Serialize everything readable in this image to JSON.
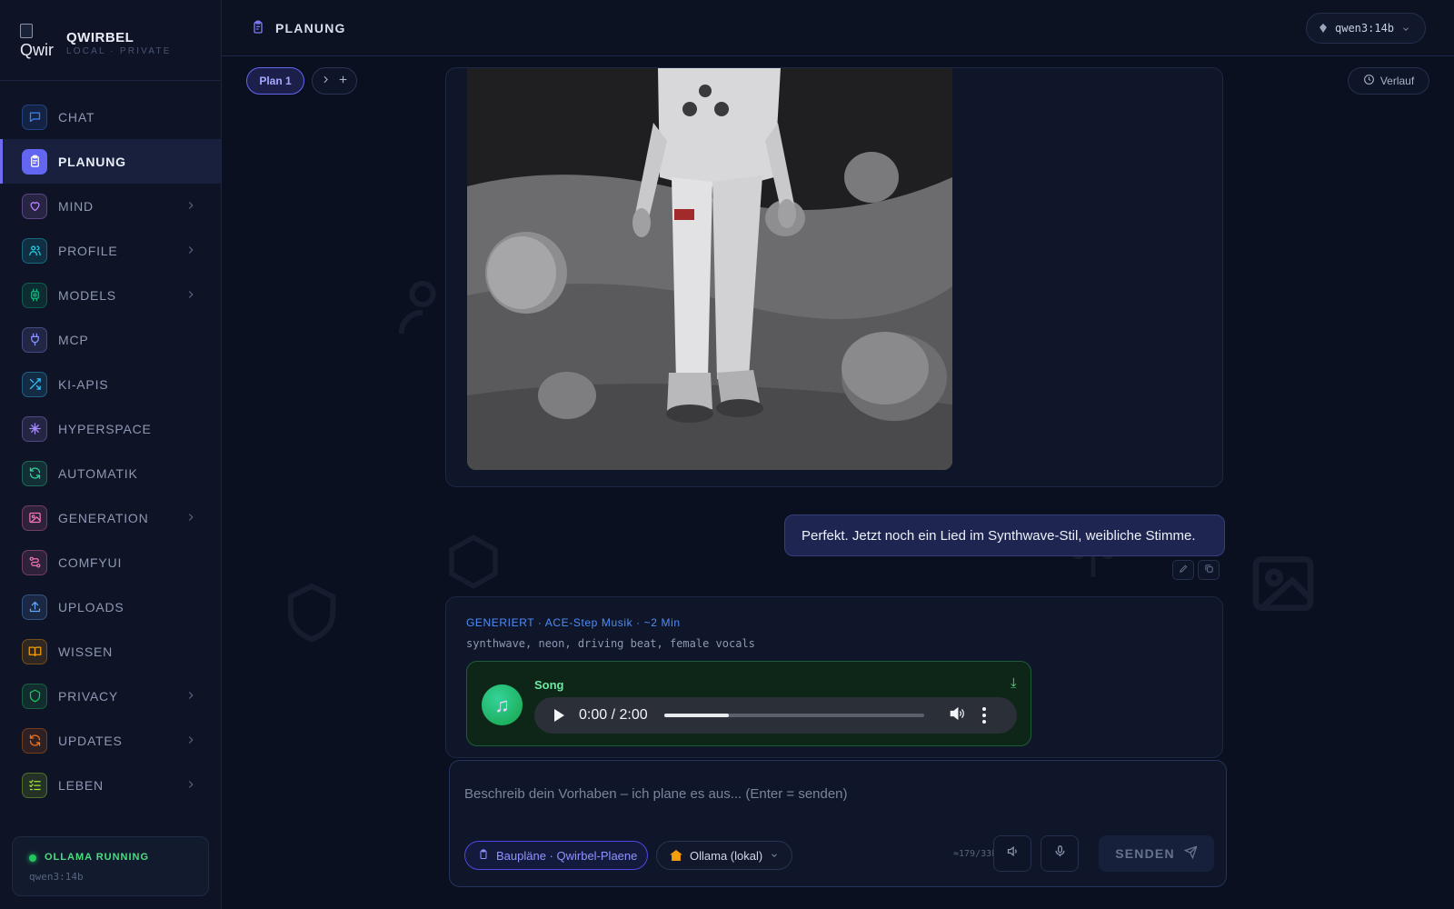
{
  "brand": {
    "logo_alt": "Qwir",
    "name": "QWIRBEL",
    "subtitle": "LOCAL · PRIVATE"
  },
  "sidebar": {
    "items": [
      {
        "label": "CHAT",
        "icon": "chat-icon",
        "color": "#3b82f6",
        "has_chevron": false,
        "active": false
      },
      {
        "label": "PLANUNG",
        "icon": "clipboard-icon",
        "color": "#6366f1",
        "has_chevron": false,
        "active": true
      },
      {
        "label": "MIND",
        "icon": "heart-icon",
        "color": "#c084fc",
        "has_chevron": true,
        "active": false
      },
      {
        "label": "PROFILE",
        "icon": "users-icon",
        "color": "#22d3ee",
        "has_chevron": true,
        "active": false
      },
      {
        "label": "MODELS",
        "icon": "cpu-icon",
        "color": "#10b981",
        "has_chevron": true,
        "active": false
      },
      {
        "label": "MCP",
        "icon": "plug-icon",
        "color": "#8b93ff",
        "has_chevron": false,
        "active": false
      },
      {
        "label": "KI-APIS",
        "icon": "shuffle-icon",
        "color": "#38bdf8",
        "has_chevron": false,
        "active": false
      },
      {
        "label": "HYPERSPACE",
        "icon": "sparkle-icon",
        "color": "#a78bfa",
        "has_chevron": false,
        "active": false
      },
      {
        "label": "AUTOMATIK",
        "icon": "refresh-icon",
        "color": "#34d399",
        "has_chevron": false,
        "active": false
      },
      {
        "label": "GENERATION",
        "icon": "image-icon",
        "color": "#f472b6",
        "has_chevron": true,
        "active": false
      },
      {
        "label": "COMFYUI",
        "icon": "workflow-icon",
        "color": "#f472b6",
        "has_chevron": false,
        "active": false
      },
      {
        "label": "UPLOADS",
        "icon": "upload-icon",
        "color": "#60a5fa",
        "has_chevron": false,
        "active": false
      },
      {
        "label": "WISSEN",
        "icon": "book-icon",
        "color": "#f59e0b",
        "has_chevron": false,
        "active": false
      },
      {
        "label": "PRIVACY",
        "icon": "shield-icon",
        "color": "#22c55e",
        "has_chevron": true,
        "active": false
      },
      {
        "label": "UPDATES",
        "icon": "refresh-icon",
        "color": "#f97316",
        "has_chevron": true,
        "active": false
      },
      {
        "label": "LEBEN",
        "icon": "checklist-icon",
        "color": "#a3e635",
        "has_chevron": true,
        "active": false
      }
    ],
    "status": {
      "title": "OLLAMA RUNNING",
      "model": "qwen3:14b"
    }
  },
  "header": {
    "page_title": "PLANUNG",
    "model_select": "qwen3:14b"
  },
  "tabs": {
    "active_tab": "Plan 1",
    "history_label": "Verlauf"
  },
  "chat": {
    "user_message": "Perfekt. Jetzt noch ein Lied im Synthwave-Stil, weibliche Stimme.",
    "generated": {
      "label": "GENERIERT · ACE-Step Musik · ~2 Min",
      "tags": "synthwave, neon, driving beat, female vocals",
      "song_title": "Song",
      "song_icon": "♫",
      "download_icon": "⤓",
      "player_time": "0:00 / 2:00",
      "progress_fraction": 0.25
    }
  },
  "composer": {
    "placeholder": "Beschreib dein Vorhaben – ich plane es aus... (Enter = senden)",
    "plan_chip": "Baupläne · Qwirbel-Plaene",
    "provider_chip": "Ollama (lokal)",
    "token_count": "≈179/33k",
    "send_label": "SENDEN"
  }
}
